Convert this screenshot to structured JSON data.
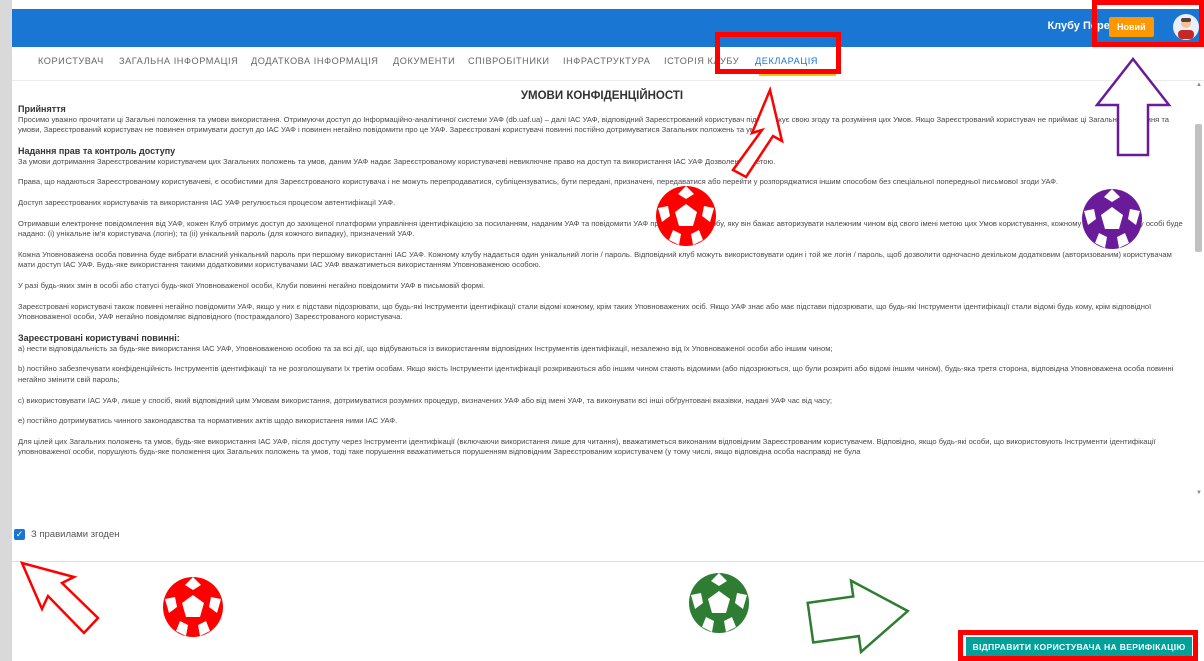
{
  "header": {
    "brand": "Клубу Перевірка",
    "new_badge": "Новий"
  },
  "tabs": [
    {
      "label": "КОРИСТУВАЧ"
    },
    {
      "label": "ЗАГАЛЬНА ІНФОРМАЦІЯ"
    },
    {
      "label": "ДОДАТКОВА ІНФОРМАЦІЯ"
    },
    {
      "label": "ДОКУМЕНТИ"
    },
    {
      "label": "СПІВРОБІТНИКИ"
    },
    {
      "label": "ІНФРАСТРУКТУРА"
    },
    {
      "label": "ІСТОРІЯ КЛУБУ"
    },
    {
      "label": "ДЕКЛАРАЦІЯ",
      "active": true
    }
  ],
  "document": {
    "title": "УМОВИ КОНФІДЕНЦІЙНОСТІ",
    "s1_heading": "Прийняття",
    "s1_text": "Просимо уважно прочитати ці Загальні положення та умови використання. Отримуючи доступ до Інформаційно-аналітичної системи УАФ (db.uaf.ua) – далі ІАС УАФ, відповідний Зареєстрований користувач підтверджує свою згоду та розуміння цих Умов. Якщо Зареєстрований користувач не приймає ці Загальні положення та умови, Зареєстрований користувач не повинен отримувати доступ до ІАС УАФ і повинен негайно повідомити про це УАФ. Зареєстровані користувачі повинні постійно дотримуватися Загальних положень та умов.",
    "s2_heading": "Надання прав та контроль доступу",
    "s2_p1": "За умови дотримання Зареєстрованим користувачем цих Загальних положень та умов, даним УАФ надає Зареєстрованому користувачеві невиключне право на доступ та використання ІАС УАФ Дозволеною метою.",
    "s2_p2": "Права, що надаються Зареєстрованому користувачеві, є особистими для Зареєстрованого користувача і не можуть перепродаватися, субліцензуватись, бути передані, призначені, передаватися або перейти у розпоряджатися іншим способом без спеціальної попередньої письмової згоди УАФ.",
    "s2_p3": "Доступ зареєстрованих користувачів та використання ІАС УАФ регулюється процесом автентифікації УАФ.",
    "s2_p4": "Отримавши електронне повідомлення від УАФ, кожен Клуб отримує доступ до захищеної платформи управління ідентифікацією за посиланням, наданим УАФ та повідомити УАФ про відповідну особу, яку він бажає авторизувати належним чином від свого імені метою цих Умов користування, кожному Уповноваженому особі буде надано: (і) унікальне ім'я користувача (логін); та (іі) унікальний пароль (для кожного випадку), призначений УАФ.",
    "s2_p5": "Кожна Уповноважена особа повинна буде вибрати власний унікальний пароль при першому використанні ІАС УАФ. Кожному клубу надається один унікальний логін / пароль. Відповідний клуб можуть використовувати один і той же логін / пароль, щоб дозволити одночасно декільком додатковим (авторизованим) користувачам мати доступ ІАС УАФ. Будь-яке використання такими додатковими користувачами ІАС УАФ вважатиметься використанням Уповноваженою особою.",
    "s2_p6": "У разі будь-яких змін в особі або статусі будь-якої Уповноваженої особи, Клуби повинні негайно повідомити УАФ в письмовій формі.",
    "s2_p7": "Зареєстровані користувачі також повинні негайно повідомити УАФ, якщо у них є підстави підозрювати, що будь-які Інструменти ідентифікації стали відомі кожному, крім таких Уповноважених осіб. Якщо УАФ знає або має підстави підозрювати, що будь-які Інструменти ідентифікації стали відомі будь кому, крім відповідної Уповноваженої особи, УАФ негайно повідомляє відповідного (постраждалого) Зареєстрованого користувача.",
    "s3_heading": "Зареєстровані користувачі повинні:",
    "s3_a": "а) нести відповідальність за будь-яке використання ІАС УАФ, Уповноваженою особою та за всі дії, що відбуваються із використанням відповідних Інструментів ідентифікації, незалежно від їх Уповноваженої особи або іншим чином;",
    "s3_b": "b) постійно забезпечувати конфіденційність Інструментів ідентифікації та не розголошувати їх третім особам. Якщо якість Інструменти ідентифікації розкриваються або іншим чином стають відомими (або підозрюються, що були розкриті або відомі іншим чином), будь-яка третя сторона, відповідна Уповноважена особа повинні негайно змінити свій пароль;",
    "s3_c": "c) використовувати ІАС УАФ, лише у спосіб, який відповідний цим Умовам використання, дотримуватися розумних процедур, визначених УАФ або від імені УАФ, та виконувати всі інші обґрунтовані вказівки, надані УАФ час від часу;",
    "s3_e": "e) постійно дотримуватись чинного законодавства та нормативних актів щодо використання ними ІАС УАФ.",
    "s3_last": "Для цілей цих Загальних положень та умов, будь-яке використання ІАС УАФ, після доступу через Інструменти ідентифікації (включаючи використання лише для читання), вважатиметься виконаним відповідним Зареєстрованим користувачем. Відповідно, якщо будь-які особи, що використовують Інструменти ідентифікації уповноваженої особи, порушують будь-яке положення цих Загальних положень та умов, тоді таке порушення вважатиметься порушенням відповідним Зареєстрованим користувачем (у тому числі, якщо відповідна особа насправді не була"
  },
  "agree": {
    "label": "З правилами згоден",
    "checked": true
  },
  "submit": {
    "label": "ВІДПРАВИТИ КОРИСТУВАЧА НА ВЕРИФІКАЦІЮ"
  },
  "colors": {
    "primary": "#1976d2",
    "badge": "#ff9800",
    "submit": "#00a19a",
    "annotation_red": "#ff0000",
    "annotation_purple": "#6a1b9a",
    "annotation_green": "#2e7d32"
  }
}
